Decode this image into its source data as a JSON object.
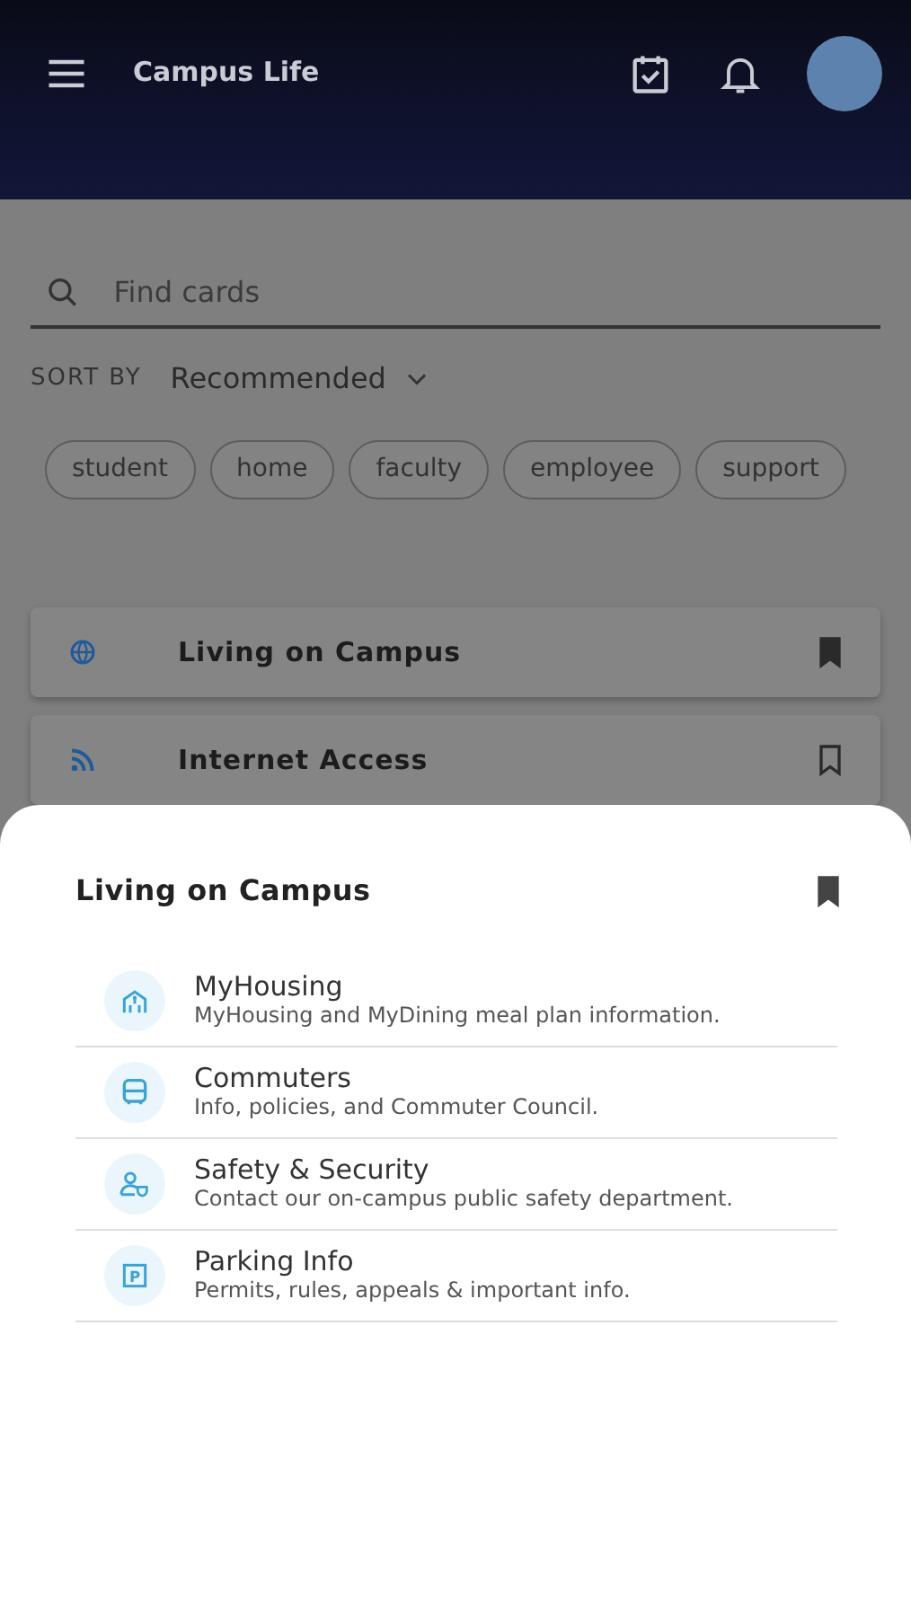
{
  "app_bar": {
    "title": "Campus Life"
  },
  "search": {
    "placeholder": "Find cards"
  },
  "sort": {
    "label": "SORT BY",
    "value": "Recommended"
  },
  "tags": [
    {
      "label": "student"
    },
    {
      "label": "home"
    },
    {
      "label": "faculty"
    },
    {
      "label": "employee"
    },
    {
      "label": "support"
    }
  ],
  "cards": [
    {
      "kind": "globe",
      "title": "Living on Campus",
      "bookmarked": true
    },
    {
      "kind": "rss",
      "title": "Internet Access",
      "bookmarked": false
    }
  ],
  "sheet": {
    "title": "Living on Campus",
    "bookmarked": true,
    "items": [
      {
        "kind": "house",
        "title": "MyHousing",
        "subtitle": "MyHousing and MyDining meal plan information."
      },
      {
        "kind": "bus",
        "title": "Commuters",
        "subtitle": "Info, policies, and Commuter Council."
      },
      {
        "kind": "guard",
        "title": "Safety & Security",
        "subtitle": "Contact our on-campus public safety department."
      },
      {
        "kind": "parking",
        "icon_text": "P",
        "title": "Parking Info",
        "subtitle": "Permits, rules, appeals & important info."
      }
    ]
  }
}
